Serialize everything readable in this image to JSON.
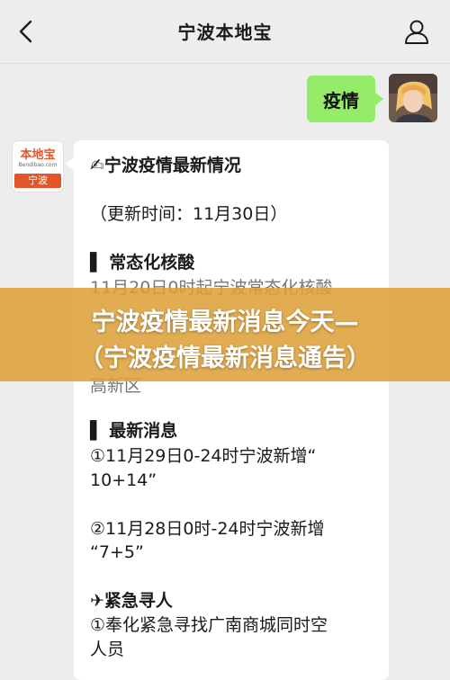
{
  "header": {
    "title": "宁波本地宝"
  },
  "outgoing_message": {
    "text": "疫情"
  },
  "bot": {
    "logo_text": "本地宝",
    "logo_url": "Bendibao.com",
    "logo_city": "宁波"
  },
  "incoming_message": {
    "lines": [
      "✍宁波疫情最新情况",
      "（更新时间：11月30日）",
      "▌ 常态化核酸",
      "11月20日0时起宁波常态化核酸",
      "高新区",
      "▌ 最新消息",
      "①11月29日0-24时宁波新增“",
      "10+14”",
      "②11月28日0时-24时宁波新增",
      "“7+5”",
      "✈紧急寻人",
      "①奉化紧急寻找广南商城同时空",
      "人员"
    ]
  },
  "banner": {
    "line1": "宁波疫情最新消息今天—",
    "line2": "（宁波疫情最新消息通告）"
  },
  "colors": {
    "outgoing_bubble": "#95ec69",
    "incoming_bubble": "#ffffff",
    "background": "#ededed",
    "banner": "#dda036",
    "brand": "#e3562a"
  },
  "icons": {
    "back": "chevron-left-icon",
    "profile": "person-icon"
  }
}
